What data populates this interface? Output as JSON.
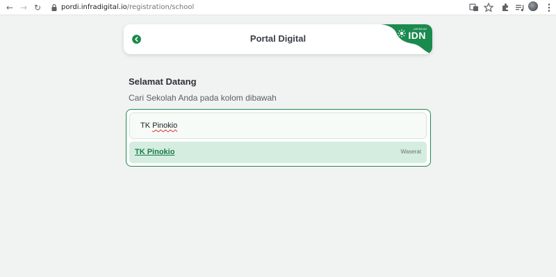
{
  "browser": {
    "url_host": "pordi.infradigital.io",
    "url_path": "/registration/school"
  },
  "header": {
    "title": "Portal Digital",
    "brand_small": "JARINGAN",
    "brand_name": "IDN",
    "brand_color": "#1b8a4e"
  },
  "welcome": {
    "title": "Selamat Datang",
    "subtitle": "Cari Sekolah Anda pada kolom dibawah"
  },
  "search": {
    "value_prefix": "TK ",
    "value_misspelled": "Pinokio"
  },
  "results": [
    {
      "name": "TK Pinokio",
      "location": "Waserat"
    }
  ],
  "icons": [
    "back-arrow-icon",
    "forward-arrow-icon",
    "reload-icon",
    "lock-icon",
    "translate-icon",
    "star-icon",
    "extensions-icon",
    "media-icon",
    "avatar",
    "menu-icon",
    "back-circle-icon",
    "sun-icon"
  ]
}
